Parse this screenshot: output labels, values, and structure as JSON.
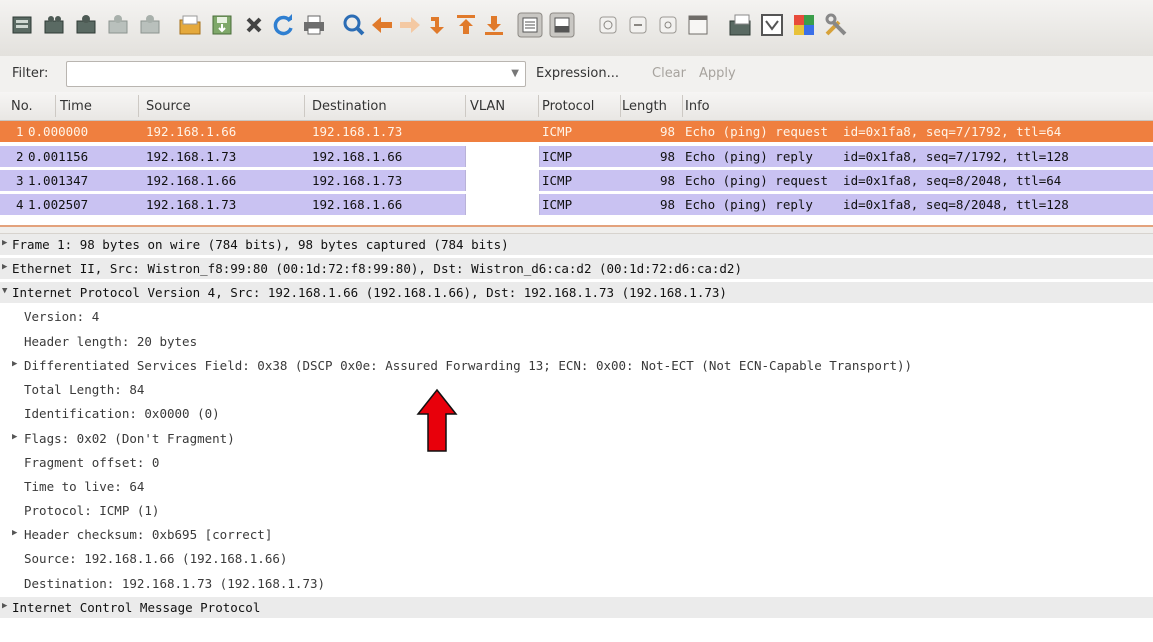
{
  "toolbar": {
    "icons": [
      "interface-list-icon",
      "capture-options-icon",
      "start-capture-icon",
      "stop-capture-icon",
      "restart-capture-icon",
      "open-file-icon",
      "save-file-icon",
      "close-file-icon",
      "reload-icon",
      "print-icon",
      "find-icon",
      "go-back-icon",
      "go-forward-icon",
      "go-to-packet-icon",
      "go-first-icon",
      "go-last-icon",
      "colorize-icon",
      "auto-scroll-icon",
      "zoom-in-icon",
      "zoom-out-icon",
      "normal-size-icon",
      "resize-columns-icon",
      "capture-filters-icon",
      "display-filters-icon",
      "coloring-rules-icon",
      "preferences-icon"
    ]
  },
  "filter": {
    "label": "Filter:",
    "value": "",
    "expression": "Expression...",
    "clear": "Clear",
    "apply": "Apply"
  },
  "packet_list": {
    "columns": [
      "No.",
      "Time",
      "Source",
      "Destination",
      "VLAN",
      "Protocol",
      "Length",
      "Info"
    ],
    "rows": [
      {
        "no": "1",
        "time": "0.000000",
        "src": "192.168.1.66",
        "dst": "192.168.1.73",
        "vlan": "",
        "proto": "ICMP",
        "len": "98",
        "info": "Echo (ping) request  id=0x1fa8, seq=7/1792, ttl=64"
      },
      {
        "no": "2",
        "time": "0.001156",
        "src": "192.168.1.73",
        "dst": "192.168.1.66",
        "vlan": "",
        "proto": "ICMP",
        "len": "98",
        "info": "Echo (ping) reply    id=0x1fa8, seq=7/1792, ttl=128"
      },
      {
        "no": "3",
        "time": "1.001347",
        "src": "192.168.1.66",
        "dst": "192.168.1.73",
        "vlan": "",
        "proto": "ICMP",
        "len": "98",
        "info": "Echo (ping) request  id=0x1fa8, seq=8/2048, ttl=64"
      },
      {
        "no": "4",
        "time": "1.002507",
        "src": "192.168.1.73",
        "dst": "192.168.1.66",
        "vlan": "",
        "proto": "ICMP",
        "len": "98",
        "info": "Echo (ping) reply    id=0x1fa8, seq=8/2048, ttl=128"
      }
    ],
    "selected_row_color": "#ef7f3f",
    "reply_row_color": "#c9c2f2"
  },
  "details": {
    "frame": "Frame 1: 98 bytes on wire (784 bits), 98 bytes captured (784 bits)",
    "ethernet": "Ethernet II, Src: Wistron_f8:99:80 (00:1d:72:f8:99:80), Dst: Wistron_d6:ca:d2 (00:1d:72:d6:ca:d2)",
    "ip": "Internet Protocol Version 4, Src: 192.168.1.66 (192.168.1.66), Dst: 192.168.1.73 (192.168.1.73)",
    "ip_fields": {
      "version": "Version: 4",
      "header_length": "Header length: 20 bytes",
      "dsfield": "Differentiated Services Field: 0x38 (DSCP 0x0e: Assured Forwarding 13; ECN: 0x00: Not-ECT (Not ECN-Capable Transport))",
      "total_length": "Total Length: 84",
      "identification": "Identification: 0x0000 (0)",
      "flags": "Flags: 0x02 (Don't Fragment)",
      "fragment_offset": "Fragment offset: 0",
      "ttl": "Time to live: 64",
      "protocol": "Protocol: ICMP (1)",
      "checksum": "Header checksum: 0xb695 [correct]",
      "source": "Source: 192.168.1.66 (192.168.1.66)",
      "destination": "Destination: 192.168.1.73 (192.168.1.73)"
    },
    "icmp": "Internet Control Message Protocol"
  },
  "annotation": {
    "arrow_color": "#e8000b"
  }
}
